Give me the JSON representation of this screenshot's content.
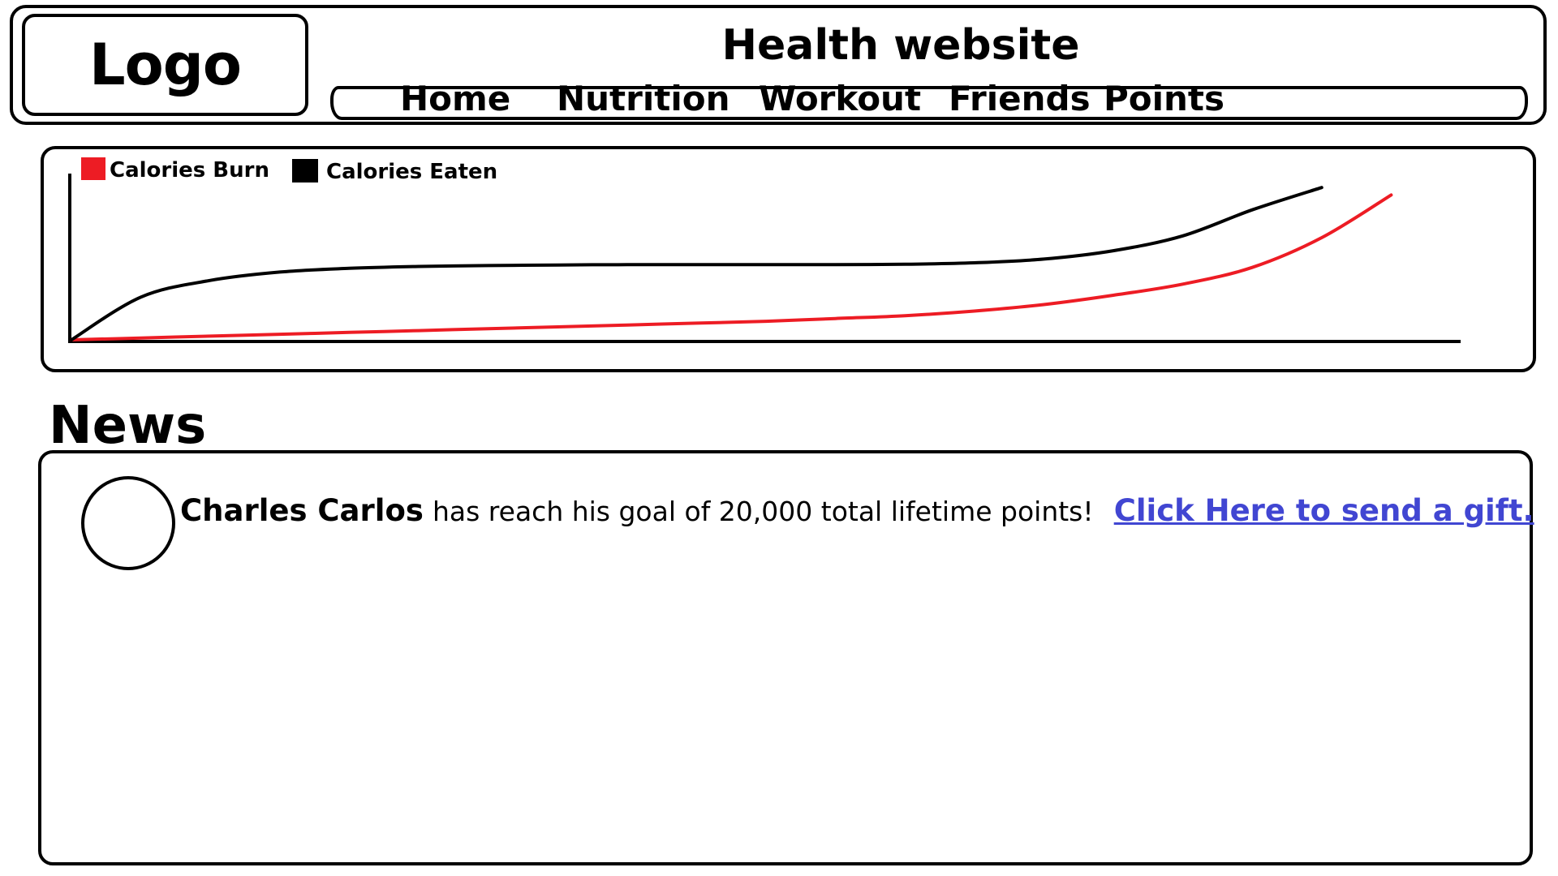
{
  "header": {
    "logo_text": "Logo",
    "site_title": "Health website"
  },
  "nav": {
    "items": [
      {
        "label": "Home"
      },
      {
        "label": "Nutrition"
      },
      {
        "label": "Workout"
      },
      {
        "label": "Friends"
      },
      {
        "label": "Points"
      }
    ]
  },
  "chart_data": {
    "type": "line",
    "title": "",
    "xlabel": "",
    "ylabel": "",
    "grid": false,
    "legend": "top-left",
    "x": [
      0,
      5,
      10,
      15,
      20,
      25,
      30,
      35,
      40,
      45,
      50,
      55,
      60,
      65,
      70,
      75,
      80,
      85,
      90,
      95,
      100
    ],
    "series": [
      {
        "name": "Calories Burn",
        "color": "#ed1c24",
        "values": [
          0,
          1,
          2,
          3,
          4,
          5,
          6,
          7,
          8,
          9,
          10,
          11.5,
          13,
          15.5,
          19,
          24,
          30,
          39,
          55,
          78,
          null
        ]
      },
      {
        "name": "Calories Eaten",
        "color": "#000000",
        "values": [
          0,
          23,
          32,
          36.5,
          38.5,
          39.5,
          40,
          40.3,
          40.5,
          40.5,
          40.5,
          40.5,
          40.7,
          41.5,
          43.5,
          48,
          56,
          70,
          82,
          null,
          null
        ]
      }
    ],
    "xlim": [
      0,
      100
    ],
    "ylim": [
      0,
      100
    ]
  },
  "news": {
    "title": "News",
    "items": [
      {
        "name": "Charles Carlos",
        "text": "has reach his goal of 20,000 total lifetime points!",
        "link": "Click Here to send a gift."
      }
    ]
  }
}
